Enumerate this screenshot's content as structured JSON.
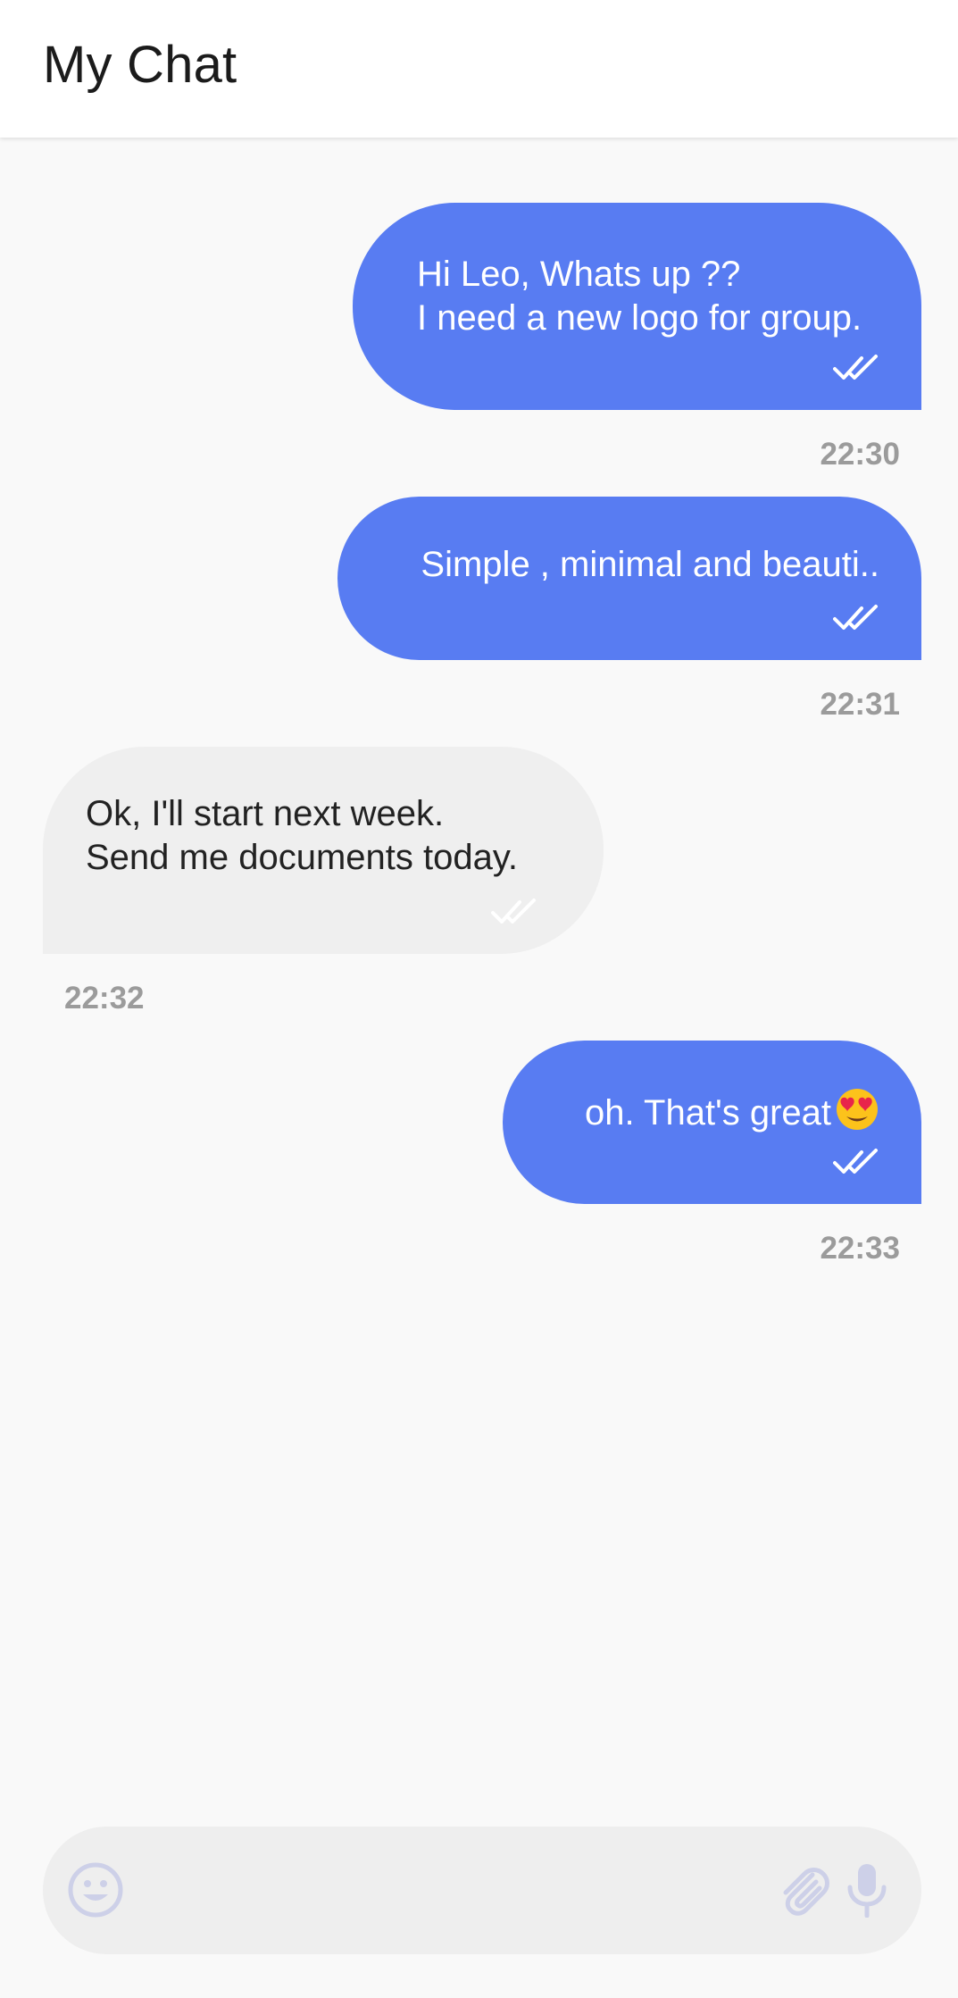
{
  "app": {
    "title": "My Chat"
  },
  "messages": [
    {
      "direction": "outgoing",
      "lines": [
        "Hi Leo, Whats up ??",
        "I need a new logo for group."
      ],
      "time": "22:30",
      "status_icon": "double-check-icon"
    },
    {
      "direction": "outgoing",
      "lines": [
        "Simple , minimal and beauti.."
      ],
      "time": "22:31",
      "status_icon": "double-check-icon"
    },
    {
      "direction": "incoming",
      "lines": [
        "Ok, I'll start next week.",
        "Send me documents today."
      ],
      "time": "22:32",
      "status_icon": "double-check-icon"
    },
    {
      "direction": "outgoing",
      "lines": [
        "oh. That's great"
      ],
      "emoji": "smiling-face-with-heart-eyes-emoji",
      "time": "22:33",
      "status_icon": "double-check-icon"
    }
  ],
  "composer": {
    "placeholder": "",
    "value": "",
    "left_icon": "emoji-icon",
    "right_icons": [
      "attachment-icon",
      "microphone-icon"
    ]
  },
  "colors": {
    "outgoing_bubble": "#587cf2",
    "incoming_bubble": "#efefef",
    "background": "#f9f9f9",
    "timestamp": "#9b9b9b",
    "composer_icons": "#cdd0e8"
  }
}
